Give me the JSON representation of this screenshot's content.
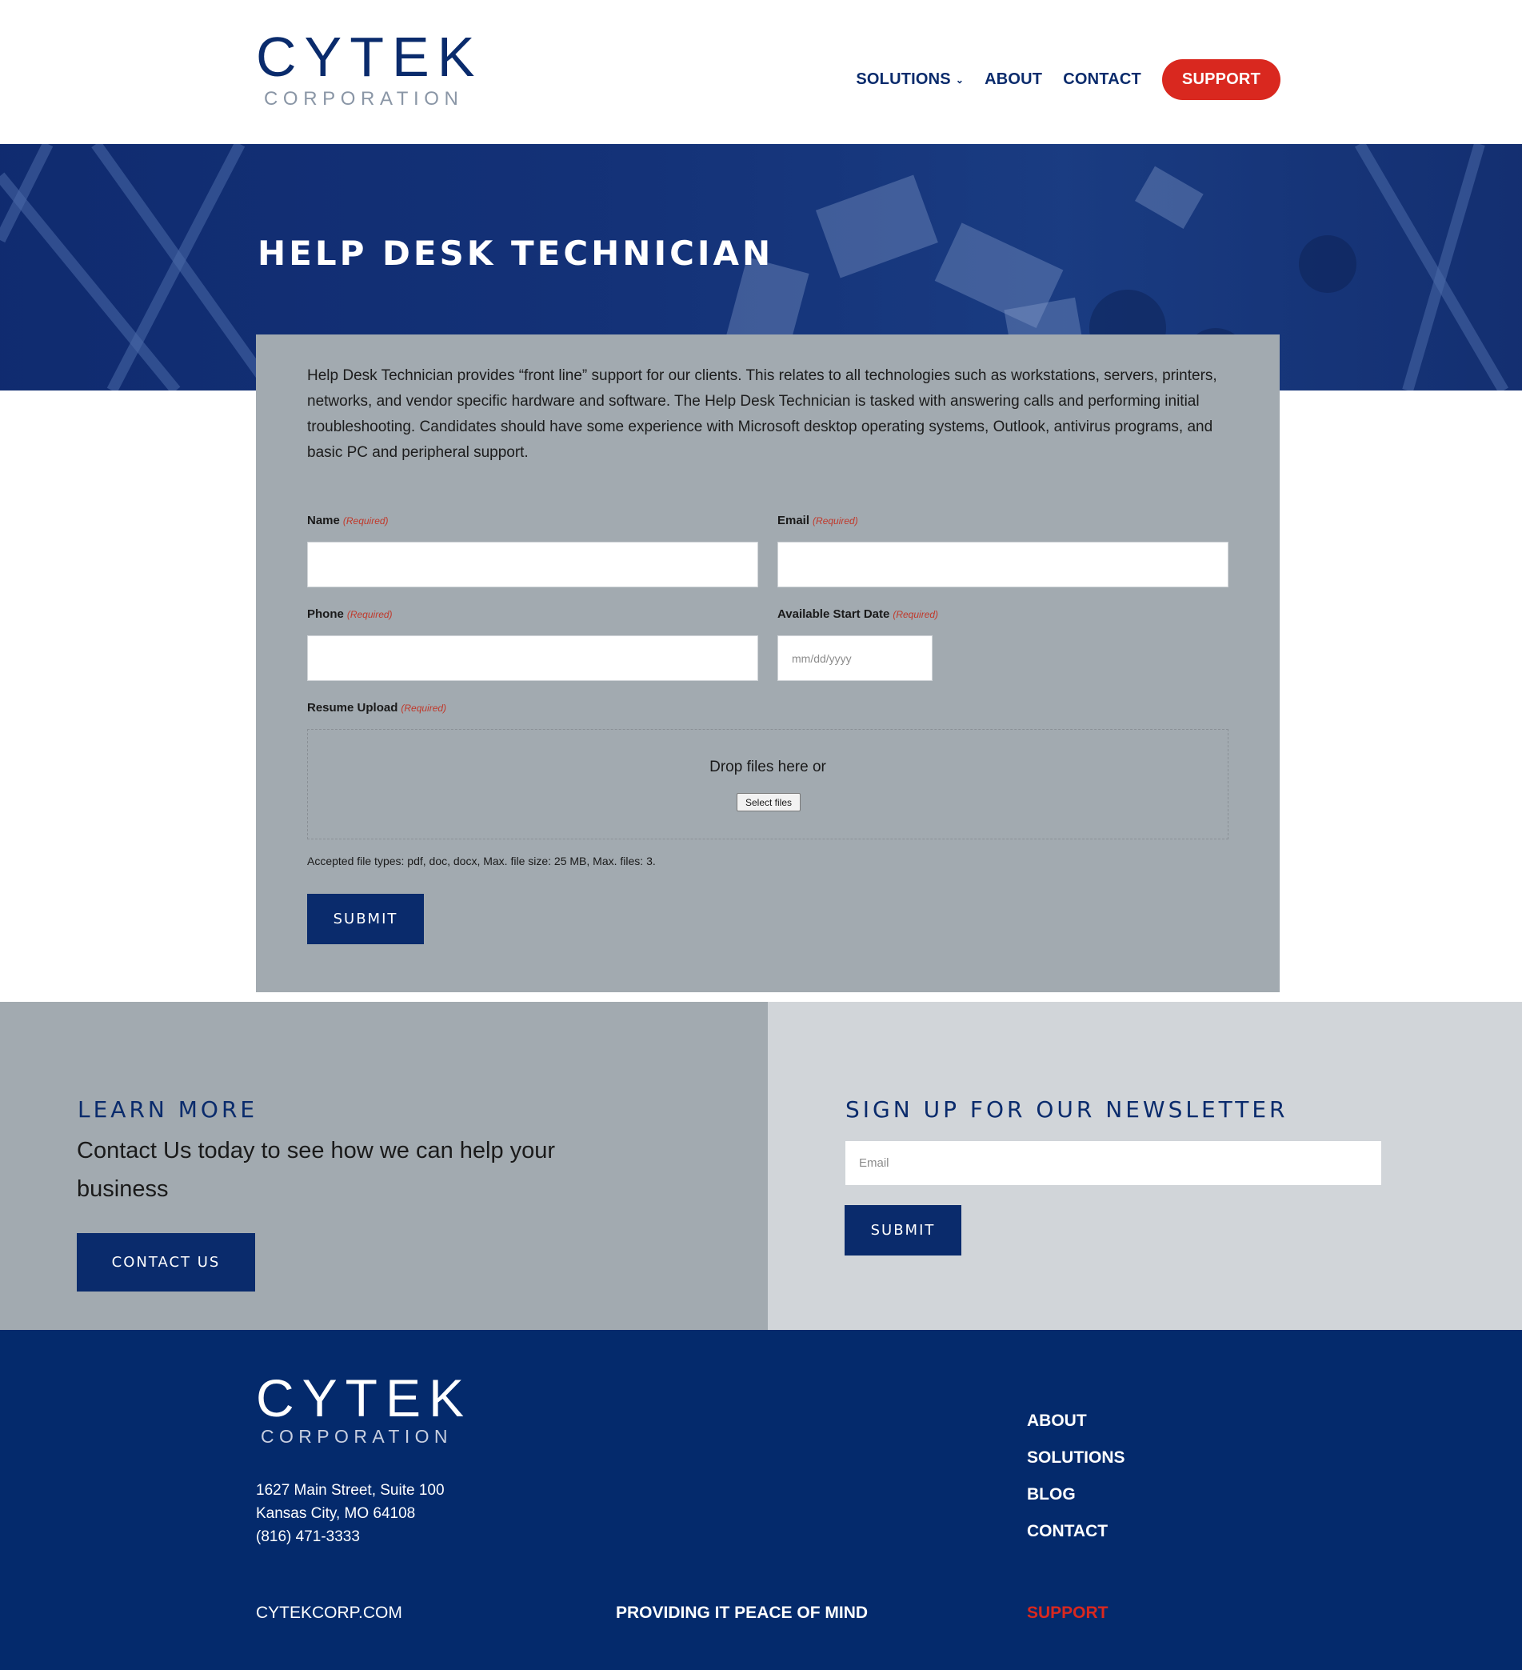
{
  "header": {
    "logo_mark": "CYTEK",
    "logo_sub": "CORPORATION",
    "nav": {
      "solutions": "SOLUTIONS",
      "about": "ABOUT",
      "contact": "CONTACT",
      "support": "SUPPORT"
    }
  },
  "hero": {
    "title": "HELP DESK TECHNICIAN"
  },
  "job": {
    "description": "Help Desk Technician provides “front line” support for our clients. This relates to all technologies such as workstations, servers, printers, networks, and vendor specific hardware and software. The Help Desk Technician is tasked with answering calls and performing initial troubleshooting. Candidates should have some experience with Microsoft desktop operating systems, Outlook, antivirus programs, and basic PC and peripheral support."
  },
  "form": {
    "required": "(Required)",
    "name_label": "Name",
    "email_label": "Email",
    "phone_label": "Phone",
    "date_label": "Available Start Date",
    "date_placeholder": "mm/dd/yyyy",
    "resume_label": "Resume Upload",
    "drop_text": "Drop files here or",
    "select_files": "Select files",
    "accepted": "Accepted file types: pdf, doc, docx, Max. file size: 25 MB, Max. files: 3.",
    "submit": "SUBMIT"
  },
  "cta": {
    "learn_more": "LEARN MORE",
    "contact_text": "Contact Us today to see how we can help your business",
    "contact_button": "CONTACT US",
    "newsletter_heading": "SIGN UP FOR OUR NEWSLETTER",
    "email_placeholder": "Email",
    "submit": "SUBMIT"
  },
  "footer": {
    "logo_mark": "CYTEK",
    "logo_sub": "CORPORATION",
    "address_line1": "1627 Main Street, Suite 100",
    "address_line2": "Kansas City, MO 64108",
    "phone": "(816) 471-3333",
    "links": [
      "ABOUT",
      "SOLUTIONS",
      "BLOG",
      "CONTACT"
    ],
    "site": "CYTEKCORP.COM",
    "tagline": "PROVIDING IT PEACE OF MIND",
    "support": "SUPPORT"
  },
  "colors": {
    "brand_navy": "#0a2b6c",
    "support_red": "#d9281f",
    "card_gray": "#a2aab0",
    "light_gray": "#d1d5d9",
    "footer_navy": "#042a6c"
  }
}
